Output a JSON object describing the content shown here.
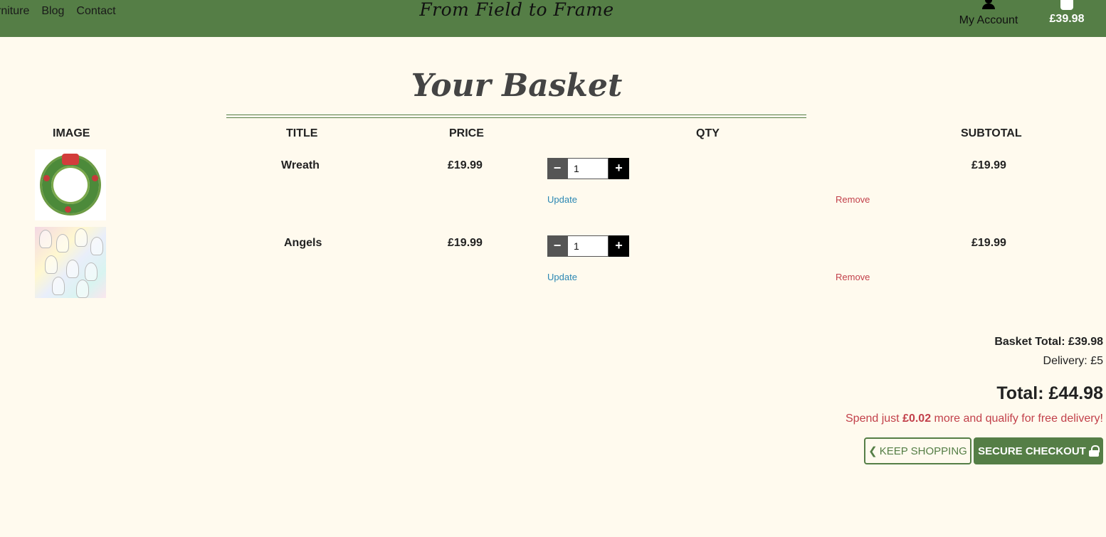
{
  "nav": {
    "items": [
      "rniture",
      "Blog",
      "Contact"
    ],
    "brand": "From Field to Frame",
    "account_label": "My Account",
    "cart_total": "£39.98"
  },
  "page": {
    "heading": "Your Basket"
  },
  "table": {
    "headers": [
      "IMAGE",
      "TITLE",
      "PRICE",
      "QTY",
      "SUBTOTAL"
    ],
    "rows": [
      {
        "title": "Wreath",
        "price": "£19.99",
        "qty": "1",
        "subtotal": "£19.99",
        "update": "Update",
        "remove": "Remove"
      },
      {
        "title": "Angels",
        "price": "£19.99",
        "qty": "1",
        "subtotal": "£19.99",
        "update": "Update",
        "remove": "Remove"
      }
    ]
  },
  "summary": {
    "basket_total": "Basket Total: £39.98",
    "delivery": "Delivery: £5",
    "grand_total": "Total: £44.98",
    "free_delivery_prefix": "Spend just ",
    "free_delivery_amount": "£0.02",
    "free_delivery_suffix": " more and qualify for free delivery!"
  },
  "buttons": {
    "keep_shopping": "KEEP SHOPPING",
    "secure_checkout": "SECURE CHECKOUT"
  },
  "icons": {
    "account": "user-icon",
    "cart": "shopping-bag-icon",
    "keep_shopping": "chevron-left-icon",
    "secure_checkout": "lock-icon"
  },
  "colors": {
    "brand_green": "#557e46",
    "background": "#fffaee",
    "link_blue": "#2b87b3",
    "alert_red": "#c2404a"
  }
}
